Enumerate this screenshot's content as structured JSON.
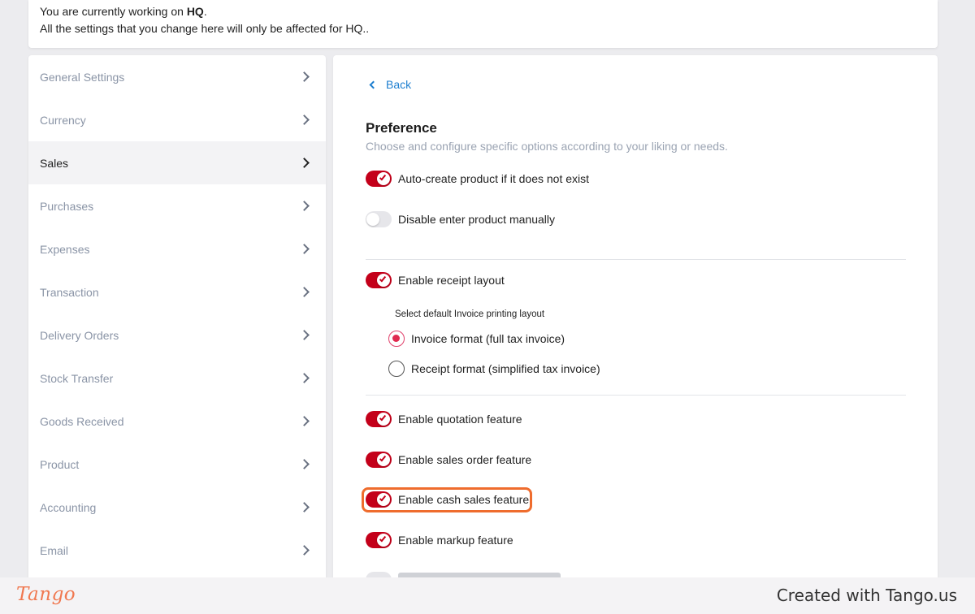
{
  "banner": {
    "line1_prefix": "You are currently working on ",
    "line1_location": "HQ",
    "line1_suffix": ".",
    "line2": "All the settings that you change here will only be affected for HQ.."
  },
  "sidebar": {
    "items": [
      {
        "label": "General Settings",
        "active": false
      },
      {
        "label": "Currency",
        "active": false
      },
      {
        "label": "Sales",
        "active": true
      },
      {
        "label": "Purchases",
        "active": false
      },
      {
        "label": "Expenses",
        "active": false
      },
      {
        "label": "Transaction",
        "active": false
      },
      {
        "label": "Delivery Orders",
        "active": false
      },
      {
        "label": "Stock Transfer",
        "active": false
      },
      {
        "label": "Goods Received",
        "active": false
      },
      {
        "label": "Product",
        "active": false
      },
      {
        "label": "Accounting",
        "active": false
      },
      {
        "label": "Email",
        "active": false
      }
    ]
  },
  "main": {
    "back_label": "Back",
    "title": "Preference",
    "subtitle": "Choose and configure specific options according to your liking or needs.",
    "options": [
      {
        "label": "Auto-create product if it does not exist",
        "enabled": true
      },
      {
        "label": "Disable enter product manually",
        "enabled": false
      },
      {
        "label": "Enable receipt layout",
        "enabled": true
      },
      {
        "label": "Enable quotation feature",
        "enabled": true
      },
      {
        "label": "Enable sales order feature",
        "enabled": true
      },
      {
        "label": "Enable cash sales feature",
        "enabled": true
      },
      {
        "label": "Enable markup feature",
        "enabled": true
      }
    ],
    "layout_label": "Select default Invoice printing layout",
    "layouts": [
      {
        "label": "Invoice format (full tax invoice)",
        "selected": true
      },
      {
        "label": "Receipt format (simplified tax invoice)",
        "selected": false
      }
    ]
  },
  "footer": {
    "logo": "Tango",
    "created": "Created with Tango.us"
  },
  "colors": {
    "accent_red": "#c4001a",
    "link_blue": "#1e7fd0",
    "highlight_orange": "#ef6c2d"
  }
}
